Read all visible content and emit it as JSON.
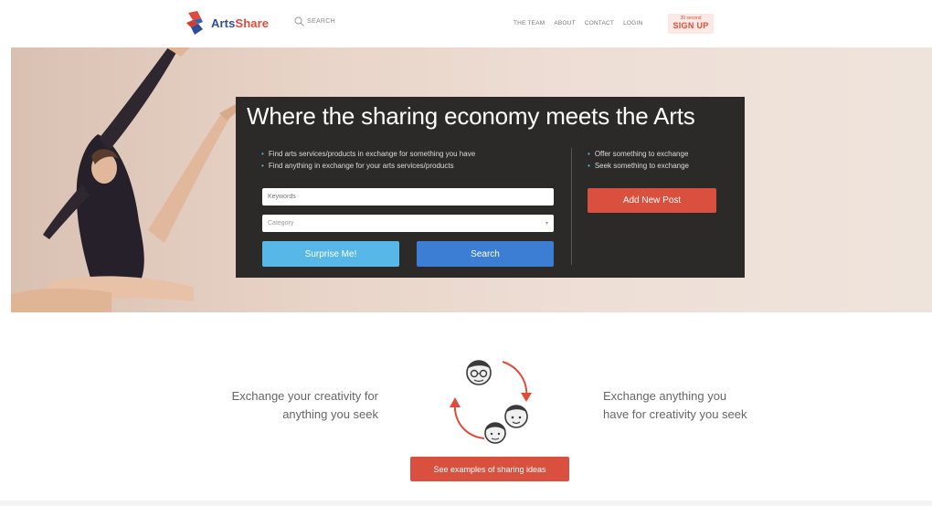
{
  "header": {
    "logo_part1": "Arts",
    "logo_part2": "Share",
    "search_label": "SEARCH",
    "nav": [
      "THE TEAM",
      "ABOUT",
      "CONTACT",
      "LOGIN"
    ],
    "signup_small": "30 second",
    "signup_big": "SIGN UP"
  },
  "hero": {
    "title": "Where the sharing economy meets the Arts",
    "left_bullets": [
      "Find arts services/products in exchange for something you have",
      "Find anything in exchange for your arts services/products"
    ],
    "right_bullets": [
      "Offer something to exchange",
      "Seek something to exchange"
    ],
    "keywords_placeholder": "Keywords",
    "category_placeholder": "Category",
    "surprise_label": "Surprise Me!",
    "search_label": "Search",
    "add_post_label": "Add New Post"
  },
  "exchange": {
    "left_line1": "Exchange your creativity for",
    "left_line2": "anything you seek",
    "right_line1": "Exchange anything you",
    "right_line2": "have for creativity you seek",
    "examples_label": "See examples of sharing ideas"
  },
  "colors": {
    "brand_blue": "#2f4c9a",
    "brand_red": "#e04b3a",
    "accent_light_blue": "#57b7e6",
    "accent_blue": "#3b7ed4",
    "panel_dark": "#2b2a29"
  }
}
